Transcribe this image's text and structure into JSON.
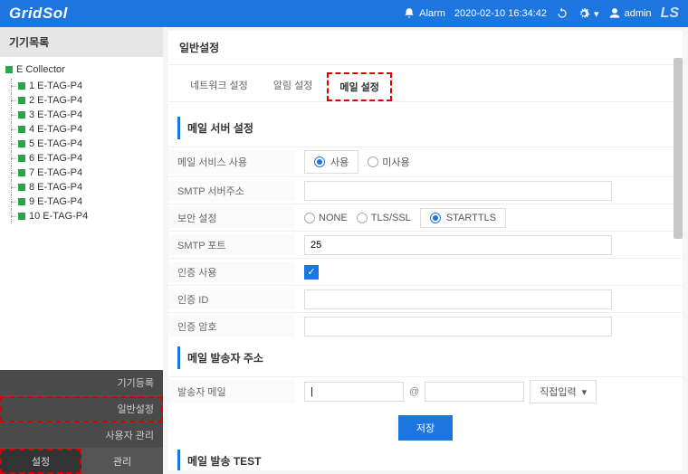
{
  "topbar": {
    "brand": "GridSol",
    "alarm": "Alarm",
    "datetime": "2020-02-10 16:34:42",
    "user": "admin",
    "ls": "LS"
  },
  "sidebar": {
    "title": "기기목록",
    "root": "E Collector",
    "items": [
      {
        "label": "1 E-TAG-P4"
      },
      {
        "label": "2 E-TAG-P4"
      },
      {
        "label": "3 E-TAG-P4"
      },
      {
        "label": "4 E-TAG-P4"
      },
      {
        "label": "5 E-TAG-P4"
      },
      {
        "label": "6 E-TAG-P4"
      },
      {
        "label": "7 E-TAG-P4"
      },
      {
        "label": "8 E-TAG-P4"
      },
      {
        "label": "9 E-TAG-P4"
      },
      {
        "label": "10 E-TAG-P4"
      }
    ],
    "menu": [
      {
        "label": "기기등록"
      },
      {
        "label": "일반설정"
      },
      {
        "label": "사용자 관리"
      }
    ],
    "bottom_tabs": {
      "settings": "설정",
      "manage": "관리"
    }
  },
  "panel": {
    "title": "일반설정",
    "tabs": [
      {
        "label": "네트워크 설정"
      },
      {
        "label": "알림 설정"
      },
      {
        "label": "메일 설정"
      }
    ],
    "sections": {
      "server": {
        "title": "메일 서버 설정",
        "rows": {
          "use": {
            "label": "메일 서비스 사용",
            "opt1": "사용",
            "opt2": "미사용"
          },
          "smtp": {
            "label": "SMTP 서버주소",
            "value": ""
          },
          "security": {
            "label": "보안 설정",
            "opt1": "NONE",
            "opt2": "TLS/SSL",
            "opt3": "STARTTLS"
          },
          "port": {
            "label": "SMTP 포트",
            "value": "25"
          },
          "auth": {
            "label": "인증 사용"
          },
          "authid": {
            "label": "인증 ID",
            "value": ""
          },
          "authpw": {
            "label": "인증 암호",
            "value": ""
          }
        }
      },
      "sender": {
        "title": "메일 발송자 주소",
        "row": {
          "label": "발송자 메일",
          "local": "",
          "domain": "",
          "select": "직접입력"
        }
      },
      "save_btn": "저장",
      "test": {
        "title": "메일 발송 TEST"
      }
    }
  }
}
